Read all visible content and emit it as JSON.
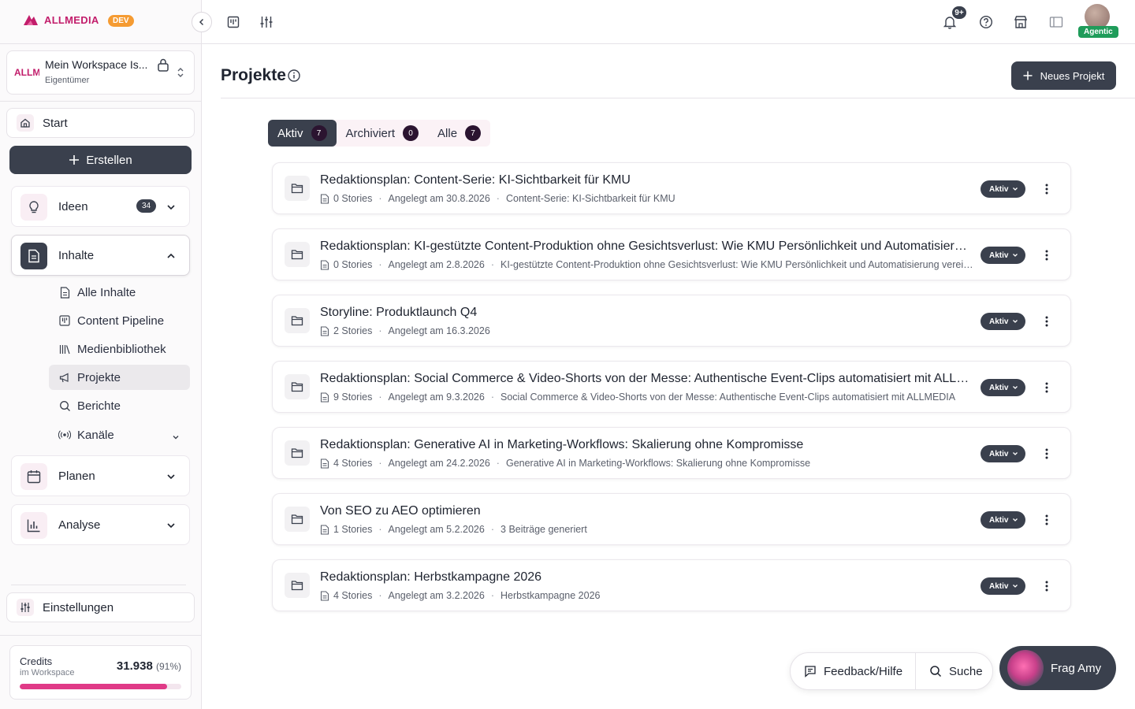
{
  "brand": {
    "logo_text": "ALLMEDIA",
    "env_badge": "DEV",
    "accent": "#c21d6b"
  },
  "workspace": {
    "logo_text": "ALLM",
    "name": "Mein Workspace Is...",
    "role": "Eigentümer"
  },
  "sidebar": {
    "start_label": "Start",
    "create_label": "Erstellen",
    "ideen": {
      "label": "Ideen",
      "count": "34"
    },
    "inhalte": {
      "label": "Inhalte",
      "sub": [
        {
          "label": "Alle Inhalte",
          "icon": "document-icon"
        },
        {
          "label": "Content Pipeline",
          "icon": "kanban-icon"
        },
        {
          "label": "Medienbibliothek",
          "icon": "library-icon"
        },
        {
          "label": "Projekte",
          "icon": "megaphone-icon",
          "active": true
        },
        {
          "label": "Berichte",
          "icon": "search-icon"
        },
        {
          "label": "Kanäle",
          "icon": "broadcast-icon"
        }
      ]
    },
    "planen_label": "Planen",
    "analyse_label": "Analyse",
    "settings_label": "Einstellungen",
    "credits": {
      "title": "Credits",
      "subtitle": "im Workspace",
      "value": "31.938",
      "percent_text": "(91%)",
      "fraction": 0.91
    }
  },
  "topbar": {
    "notification_count": "9+",
    "agentic_label": "Agentic"
  },
  "page": {
    "title": "Projekte",
    "new_project_label": "Neues Projekt",
    "tabs": [
      {
        "label": "Aktiv",
        "count": "7",
        "active": true
      },
      {
        "label": "Archiviert",
        "count": "0"
      },
      {
        "label": "Alle",
        "count": "7"
      }
    ]
  },
  "projects": [
    {
      "title": "Redaktionsplan: Content-Serie: KI-Sichtbarkeit für KMU",
      "stories": "0 Stories",
      "date": "Angelegt am 30.8.2026",
      "desc": "Content-Serie: KI-Sichtbarkeit für KMU",
      "status": "Aktiv"
    },
    {
      "title": "Redaktionsplan: KI-gestützte Content-Produktion ohne Gesichtsverlust: Wie KMU Persönlichkeit und Automatisierung vereinen",
      "stories": "0 Stories",
      "date": "Angelegt am 2.8.2026",
      "desc": "KI-gestützte Content-Produktion ohne Gesichtsverlust: Wie KMU Persönlichkeit und Automatisierung vereinen",
      "status": "Aktiv"
    },
    {
      "title": "Storyline: Produktlaunch Q4",
      "stories": "2 Stories",
      "date": "Angelegt am 16.3.2026",
      "desc": "",
      "status": "Aktiv"
    },
    {
      "title": "Redaktionsplan: Social Commerce & Video-Shorts von der Messe: Authentische Event-Clips automatisiert mit ALLMEDIA",
      "stories": "9 Stories",
      "date": "Angelegt am 9.3.2026",
      "desc": "Social Commerce & Video-Shorts von der Messe: Authentische Event-Clips automatisiert mit ALLMEDIA",
      "status": "Aktiv"
    },
    {
      "title": "Redaktionsplan: Generative AI in Marketing-Workflows: Skalierung ohne Kompromisse",
      "stories": "4 Stories",
      "date": "Angelegt am 24.2.2026",
      "desc": "Generative AI in Marketing-Workflows: Skalierung ohne Kompromisse",
      "status": "Aktiv"
    },
    {
      "title": "Von SEO zu AEO optimieren",
      "stories": "1 Stories",
      "date": "Angelegt am 5.2.2026",
      "desc": "3 Beiträge generiert",
      "status": "Aktiv"
    },
    {
      "title": "Redaktionsplan: Herbstkampagne 2026",
      "stories": "4 Stories",
      "date": "Angelegt am 3.2.2026",
      "desc": "Herbstkampagne 2026",
      "status": "Aktiv"
    }
  ],
  "bottom": {
    "feedback_label": "Feedback/Hilfe",
    "search_label": "Suche",
    "assistant_label": "Frag Amy"
  }
}
